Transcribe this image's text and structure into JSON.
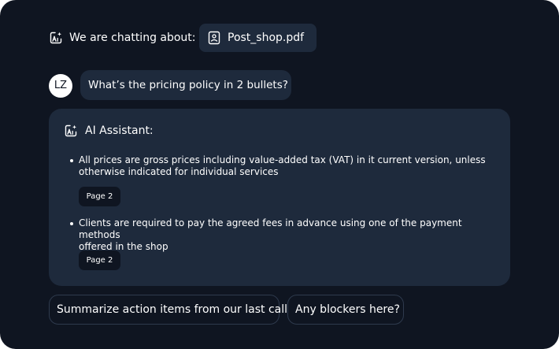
{
  "header": {
    "context_label": "We are chatting about:",
    "file_name": "Post_shop.pdf"
  },
  "user_message": {
    "initials": "LZ",
    "text": "What’s the pricing policy in 2 bullets?"
  },
  "assistant": {
    "title": "AI Assistant:",
    "bullets": [
      {
        "line1": "All prices are gross prices including value-added tax (VAT) in it current version, unless",
        "line2": "otherwise indicated for individual services",
        "source": "Page 2"
      },
      {
        "line1": "Clients are required to pay the agreed fees in advance using one of the payment methods",
        "line2": "offered in the shop",
        "source": "Page 2"
      }
    ]
  },
  "suggestions": [
    "Summarize action items from our last call",
    "Any blockers here?"
  ],
  "colors": {
    "background": "#0f1521",
    "surface": "#1e2a3c",
    "text": "#ffffff"
  },
  "icons": {
    "assistant": "ai-sparkle-icon",
    "file": "document-icon"
  }
}
